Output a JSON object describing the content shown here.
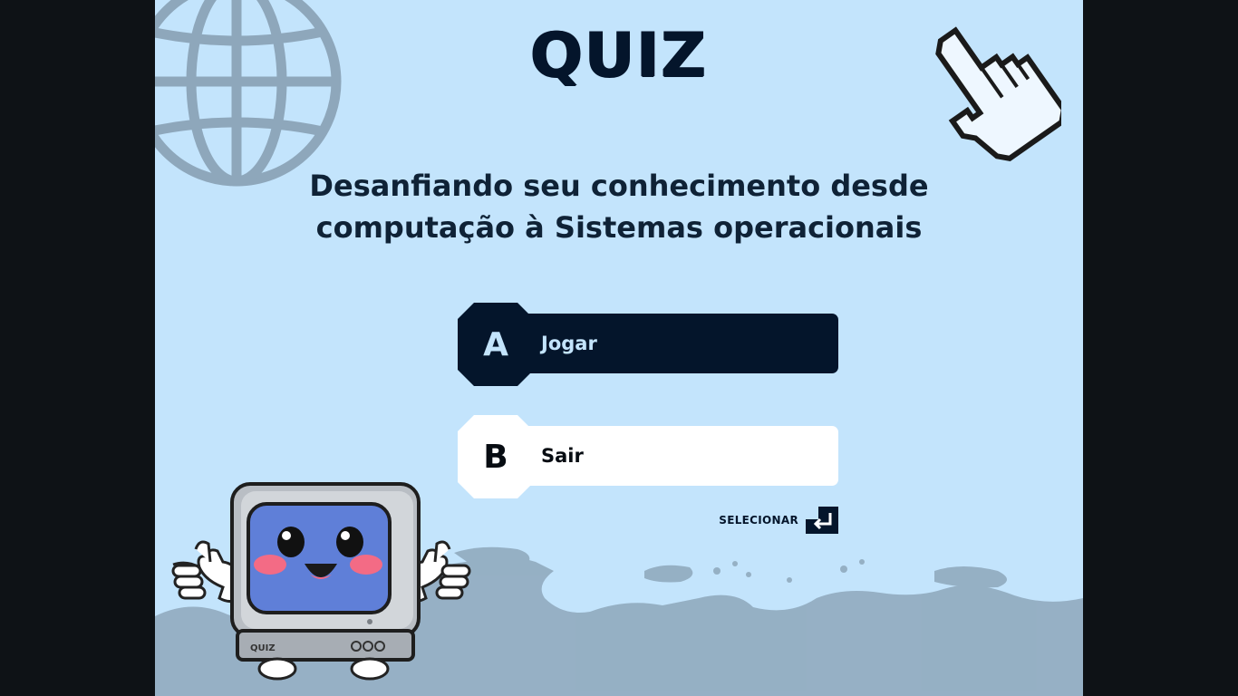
{
  "game": {
    "title": "QUIZ",
    "subtitle_line1": "Desanfiando seu conhecimento desde",
    "subtitle_line2": "computação à Sistemas operacionais"
  },
  "options": [
    {
      "key": "A",
      "label": "Jogar",
      "selected": true
    },
    {
      "key": "B",
      "label": "Sair",
      "selected": false
    }
  ],
  "hint": {
    "text": "SELECIONAR",
    "icon": "enter-key-icon"
  },
  "mascot": {
    "screen_text": "QUIZ"
  },
  "decorations": {
    "globe": "globe-icon",
    "cursor": "pixel-hand-cursor-icon",
    "map": "world-map"
  },
  "colors": {
    "background": "#c3e4fc",
    "frame": "#0e1216",
    "primary_dark": "#04152b",
    "option_light": "#ffffff",
    "decor": "#8ea7bb"
  }
}
